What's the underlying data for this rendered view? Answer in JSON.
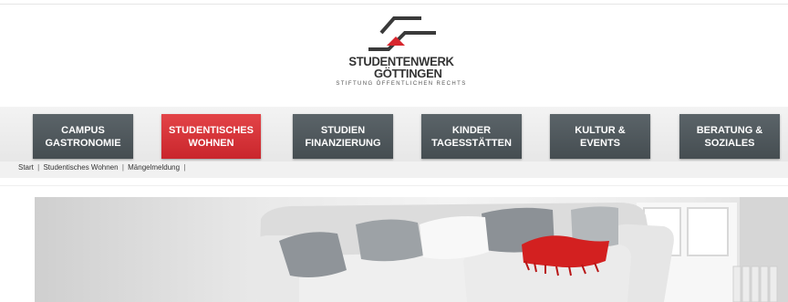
{
  "logo": {
    "line1": "STUDENTENWERK",
    "line2": "GÖTTINGEN",
    "tagline": "STIFTUNG ÖFFENTLICHEN RECHTS",
    "accent_color": "#d7262d"
  },
  "nav": {
    "items": [
      {
        "line1": "CAMPUS",
        "line2": "GASTRONOMIE",
        "active": false
      },
      {
        "line1": "STUDENTISCHES",
        "line2": "WOHNEN",
        "active": true
      },
      {
        "line1": "STUDIEN",
        "line2": "FINANZIERUNG",
        "active": false
      },
      {
        "line1": "KINDER",
        "line2": "TAGESSTÄTTEN",
        "active": false
      },
      {
        "line1": "KULTUR &",
        "line2": "EVENTS",
        "active": false
      },
      {
        "line1": "BERATUNG &",
        "line2": "SOZIALES",
        "active": false
      }
    ],
    "colors": {
      "default": "#4f585c",
      "active": "#d7262d"
    }
  },
  "breadcrumb": {
    "items": [
      "Start",
      "Studentisches Wohnen",
      "Mängelmeldung"
    ],
    "separator": "|"
  },
  "hero": {
    "image_description_icon": "sofa-with-cushions-image",
    "throw_color": "#d32020"
  }
}
